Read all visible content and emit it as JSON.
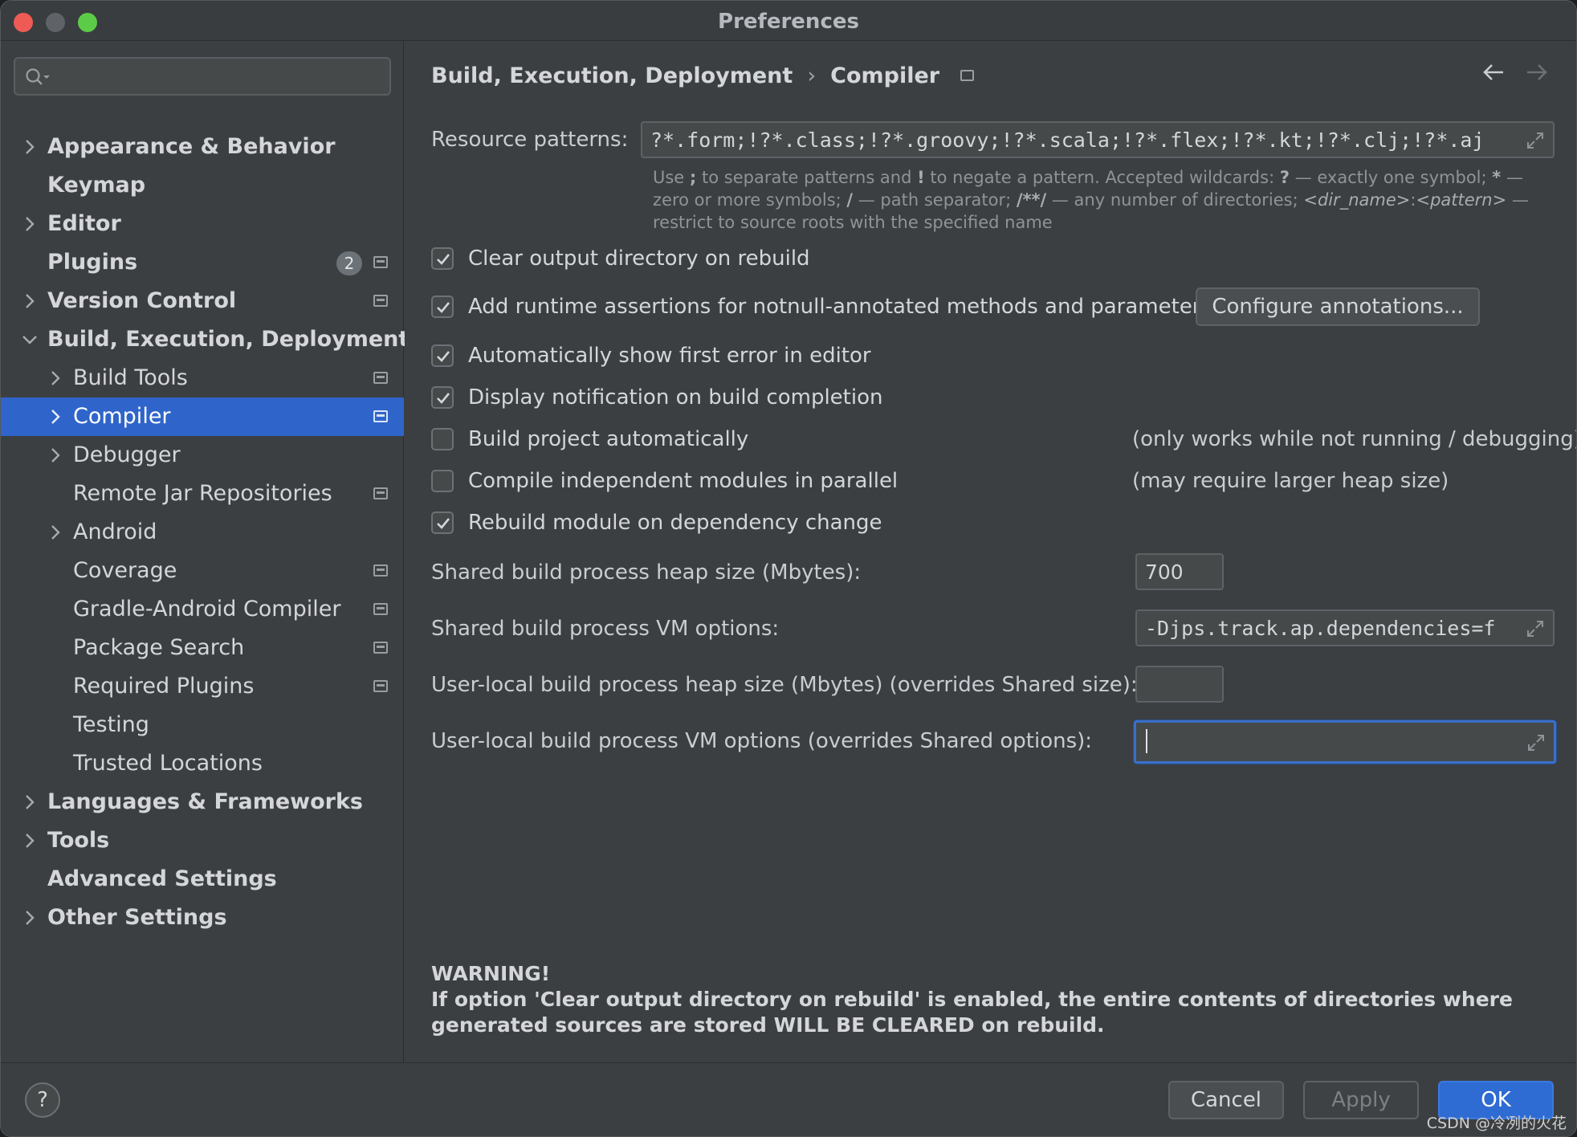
{
  "window": {
    "title": "Preferences"
  },
  "search": {
    "placeholder": ""
  },
  "sidebar": {
    "items": [
      {
        "label": "Appearance & Behavior"
      },
      {
        "label": "Keymap"
      },
      {
        "label": "Editor"
      },
      {
        "label": "Plugins",
        "badge": "2"
      },
      {
        "label": "Version Control"
      },
      {
        "label": "Build, Execution, Deployment"
      },
      {
        "label": "Build Tools"
      },
      {
        "label": "Compiler"
      },
      {
        "label": "Debugger"
      },
      {
        "label": "Remote Jar Repositories"
      },
      {
        "label": "Android"
      },
      {
        "label": "Coverage"
      },
      {
        "label": "Gradle-Android Compiler"
      },
      {
        "label": "Package Search"
      },
      {
        "label": "Required Plugins"
      },
      {
        "label": "Testing"
      },
      {
        "label": "Trusted Locations"
      },
      {
        "label": "Languages & Frameworks"
      },
      {
        "label": "Tools"
      },
      {
        "label": "Advanced Settings"
      },
      {
        "label": "Other Settings"
      }
    ]
  },
  "breadcrumb": {
    "parent": "Build, Execution, Deployment",
    "separator": "›",
    "current": "Compiler"
  },
  "resource_patterns": {
    "label": "Resource patterns:",
    "value": "?*.form;!?*.class;!?*.groovy;!?*.scala;!?*.flex;!?*.kt;!?*.clj;!?*.aj",
    "hint": {
      "t1": "Use ",
      "b1": ";",
      "t2": " to separate patterns and ",
      "b2": "!",
      "t3": " to negate a pattern. Accepted wildcards: ",
      "b3": "?",
      "t4": " — exactly one symbol; ",
      "b4": "*",
      "t5": " — zero or more symbols; ",
      "b5": "/",
      "t6": " — path separator; ",
      "b6": "/**/",
      "t7": " — any number of directories; ",
      "i1": "<dir_name>",
      "t8": ":",
      "i2": "<pattern>",
      "t9": " — restrict to source roots with the specified name"
    }
  },
  "options": [
    {
      "label": "Clear output directory on rebuild",
      "checked": true
    },
    {
      "label": "Add runtime assertions for notnull-annotated methods and parameters",
      "checked": true
    },
    {
      "label": "Automatically show first error in editor",
      "checked": true
    },
    {
      "label": "Display notification on build completion",
      "checked": true
    },
    {
      "label": "Build project automatically",
      "checked": false,
      "note": "(only works while not running / debugging)"
    },
    {
      "label": "Compile independent modules in parallel",
      "checked": false,
      "note": "(may require larger heap size)"
    },
    {
      "label": "Rebuild module on dependency change",
      "checked": true
    }
  ],
  "configure_button": "Configure annotations...",
  "heap": {
    "shared_label": "Shared build process heap size (Mbytes):",
    "shared_value": "700",
    "vm_label": "Shared build process VM options:",
    "vm_value": "-Djps.track.ap.dependencies=f",
    "local_heap_label": "User-local build process heap size (Mbytes) (overrides Shared size):",
    "local_heap_value": "",
    "local_vm_label": "User-local build process VM options (overrides Shared options):",
    "local_vm_value": ""
  },
  "warning": {
    "title": "WARNING!",
    "body": "If option 'Clear output directory on rebuild' is enabled, the entire contents of directories where generated sources are stored WILL BE CLEARED on rebuild."
  },
  "footer": {
    "help": "?",
    "cancel": "Cancel",
    "apply": "Apply",
    "ok": "OK"
  },
  "watermark": "CSDN @冷冽的火花",
  "colors": {
    "accent": "#2f65ca",
    "background": "#3c3f41",
    "text": "#d4d6d9"
  }
}
